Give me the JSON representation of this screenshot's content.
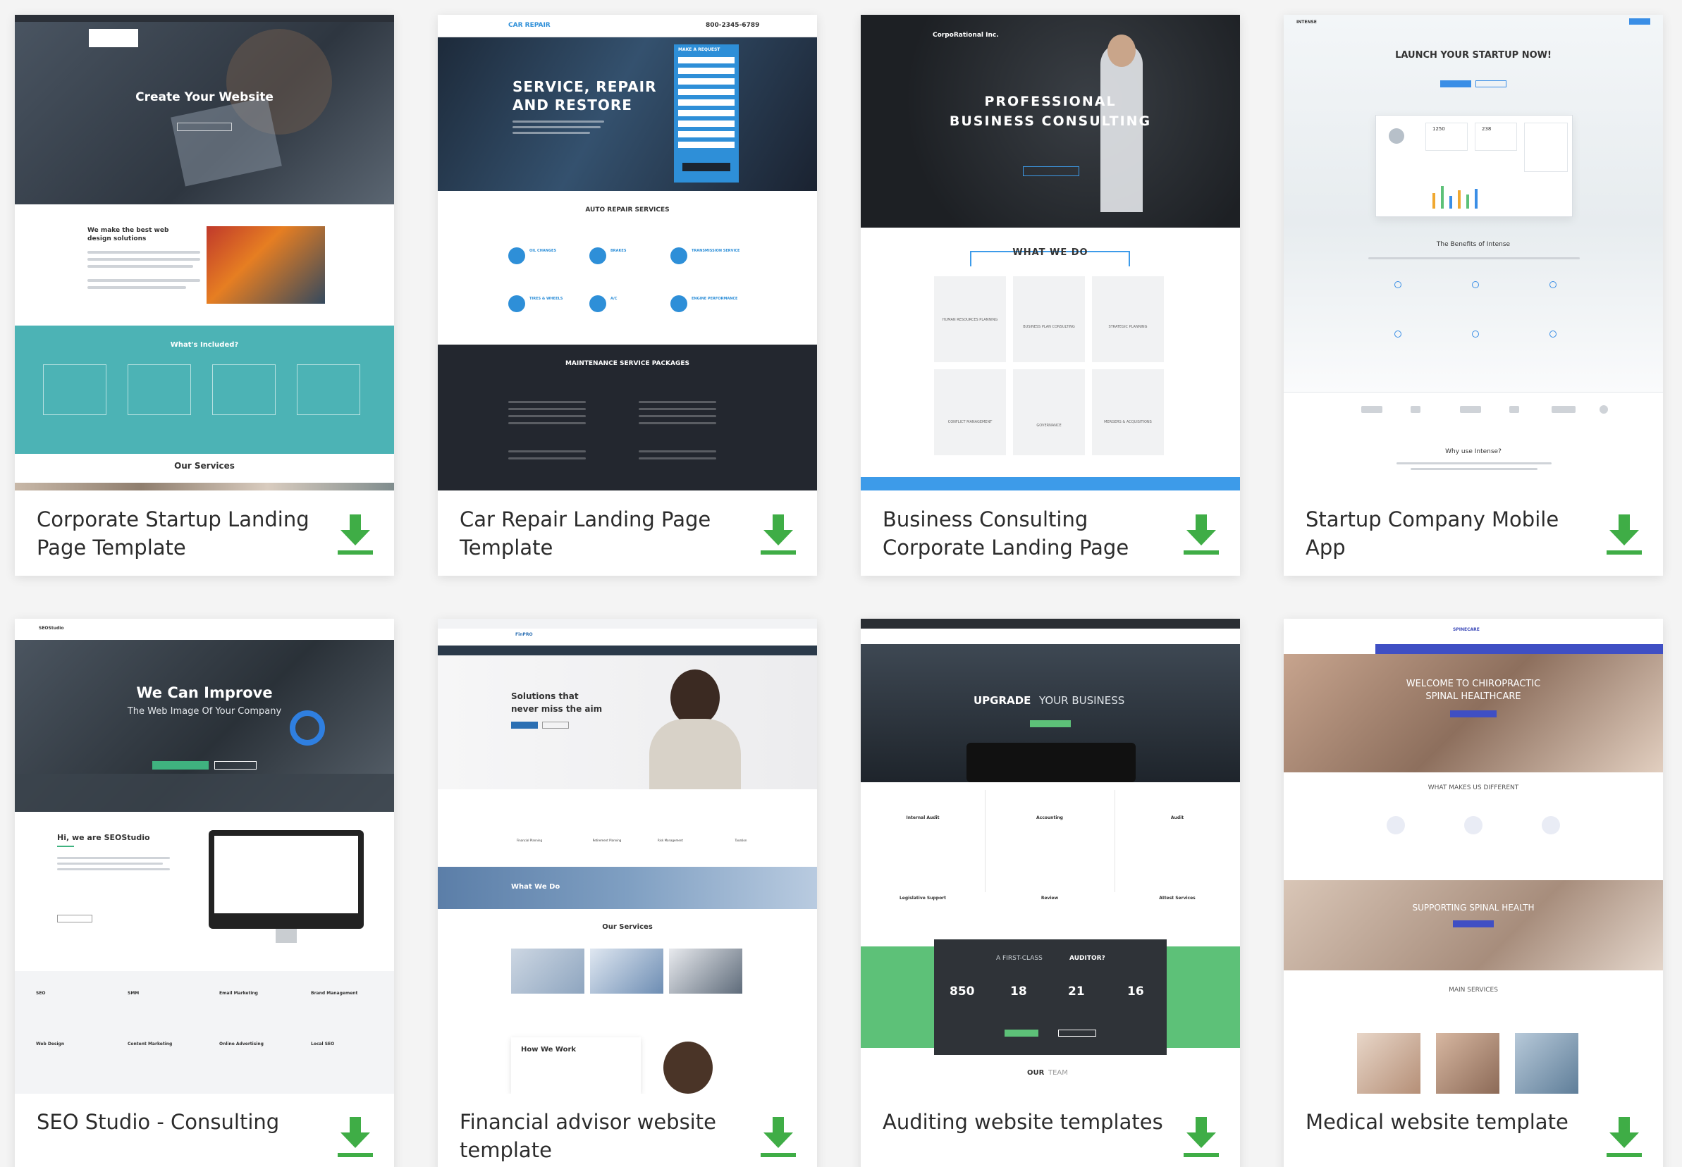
{
  "templates": [
    {
      "title": "Corporate Startup Landing Page Template",
      "preview": {
        "hero_title": "Create Your Website",
        "about_heading": "We make the best web design solutions",
        "included_heading": "What's Included?",
        "services_heading": "Our Services"
      }
    },
    {
      "title": "Car Repair Landing Page Template",
      "preview": {
        "brand": "CAR REPAIR",
        "phone": "800-2345-6789",
        "hero_title_1": "SERVICE, REPAIR",
        "hero_title_2": "AND RESTORE",
        "form_heading": "MAKE A REQUEST",
        "services_heading": "AUTO REPAIR SERVICES",
        "packages_heading": "MAINTENANCE SERVICE PACKAGES",
        "service_items": [
          "OIL CHANGES",
          "BRAKES",
          "TRANSMISSION SERVICE",
          "TIRES & WHEELS",
          "A/C",
          "ENGINE PERFORMANCE"
        ]
      }
    },
    {
      "title": "Business Consulting Corporate Landing Page",
      "preview": {
        "brand": "CorpoRational Inc.",
        "hero_title_1": "PROFESSIONAL",
        "hero_title_2": "BUSINESS CONSULTING",
        "section_heading": "WHAT WE DO",
        "tiles": [
          "HUMAN RESOURCES PLANNING",
          "BUSINESS PLAN CONSULTING",
          "STRATEGIC PLANNING",
          "CONFLICT MANAGEMENT",
          "GOVERNANCE",
          "MERGERS & ACQUISITIONS"
        ]
      }
    },
    {
      "title": "Startup Company Mobile App",
      "preview": {
        "brand": "INTENSE",
        "hero_title": "LAUNCH YOUR STARTUP NOW!",
        "benefits_heading": "The Benefits of Intense",
        "why_heading": "Why use Intense?",
        "stat_1": "1250",
        "stat_2": "238"
      }
    },
    {
      "title": "SEO Studio - Consulting",
      "preview": {
        "brand": "SEOStudio",
        "hero_title_1": "We Can Improve",
        "hero_title_2": "The Web Image Of Your Company",
        "about_heading": "Hi, we are SEOStudio",
        "features": [
          "SEO",
          "SMM",
          "Email Marketing",
          "Brand Management",
          "Web Design",
          "Content Marketing",
          "Online Advertising",
          "Local SEO"
        ]
      }
    },
    {
      "title": "Financial advisor website template",
      "preview": {
        "brand": "FinPRO",
        "hero_title_1": "Solutions that",
        "hero_title_2": "never miss the aim",
        "band_heading": "What We Do",
        "services_heading": "Our Services",
        "how_heading": "How We Work",
        "services": [
          "Financial Planning",
          "Retirement Planning",
          "Risk Management",
          "Taxation"
        ]
      }
    },
    {
      "title": "Auditing website templates",
      "preview": {
        "hero_bold": "UPGRADE",
        "hero_light": "YOUR BUSINESS",
        "features": [
          "Internal Audit",
          "Accounting",
          "Audit",
          "Legislative Support",
          "Review",
          "Attest Services"
        ],
        "cta_light": "A FIRST-CLASS",
        "cta_bold": "AUDITOR?",
        "stats": [
          "850",
          "18",
          "21",
          "16"
        ],
        "team_bold": "OUR",
        "team_light": "TEAM"
      }
    },
    {
      "title": "Medical website template",
      "preview": {
        "brand": "SPINECARE",
        "hero_title_1": "WELCOME TO CHIROPRACTIC",
        "hero_title_2": "SPINAL HEALTHCARE",
        "diff_heading": "WHAT MAKES US DIFFERENT",
        "band_heading": "SUPPORTING SPINAL HEALTH",
        "services_heading": "MAIN SERVICES"
      }
    }
  ],
  "colors": {
    "download_green": "#3fad46",
    "teal": "#4cb3b5",
    "car_dark": "#23272f",
    "car_blue": "#2e8fd8",
    "consult_blue": "#3d9be9",
    "audit_green": "#5dc178",
    "finance_blue": "#2b6fb3"
  }
}
